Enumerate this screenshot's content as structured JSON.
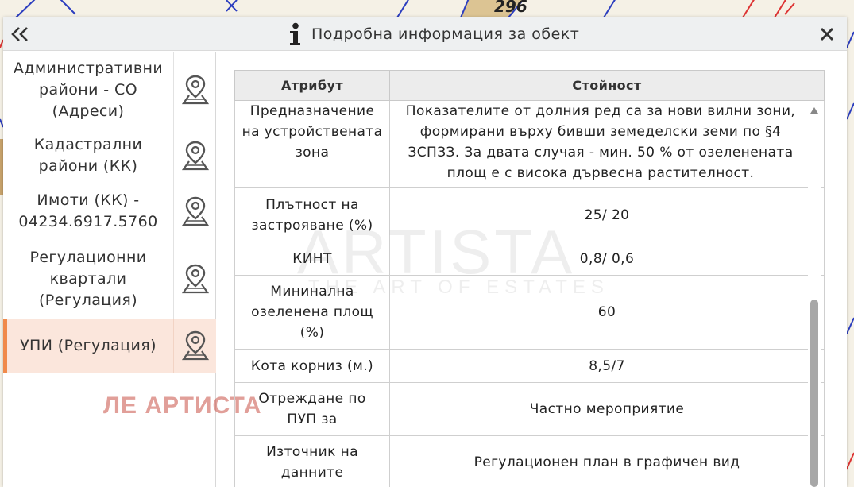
{
  "map": {
    "parcel_label": "296",
    "colors": {
      "blue_line": "#2b3dbf",
      "red_line": "#d33",
      "parcel_fill": "#dcc493"
    }
  },
  "header": {
    "title": "Подробна информация за обект",
    "collapse_icon": "double-chevron-left-icon",
    "info_icon": "info-icon",
    "close_icon": "close-icon"
  },
  "sidebar": {
    "items": [
      {
        "lines": [
          "Административни",
          "райони - СО",
          "(Адреси)"
        ],
        "active": false
      },
      {
        "lines": [
          "Кадастрални",
          "райони (КК)"
        ],
        "active": false
      },
      {
        "lines": [
          "Имоти (КК) -",
          "04234.6917.5760"
        ],
        "active": false
      },
      {
        "lines": [
          "Регулационни",
          "квартали",
          "(Регулация)"
        ],
        "active": false
      },
      {
        "lines": [
          "УПИ (Регулация)"
        ],
        "active": true
      }
    ],
    "pin_icon": "map-pin-icon",
    "active_color": "#fbe6dc",
    "active_bar_color": "#f08a4b"
  },
  "watermark_red": "ЛЕ АРТИСТА",
  "watermark_grey": {
    "main": "ARTISTA",
    "sub": "THE ART OF ESTATES"
  },
  "table": {
    "headers": {
      "attribute": "Атрибут",
      "value": "Стойност"
    },
    "rows": [
      {
        "attribute": [
          "Предназначение",
          "на устройствената",
          "зона"
        ],
        "value": [
          "Показателите от долния ред са за нови вилни зони,",
          "формирани върху бивши земеделски земи по §4",
          "ЗСПЗЗ. За двата случая - мин. 50 % от озеленената",
          "площ е с висока дървесна растителност."
        ]
      },
      {
        "attribute": [
          "Плътност на",
          "застрояване (%)"
        ],
        "value": [
          "25/ 20"
        ]
      },
      {
        "attribute": [
          "КИНТ"
        ],
        "value": [
          "0,8/ 0,6"
        ]
      },
      {
        "attribute": [
          "Мининална",
          "озеленена площ",
          "(%)"
        ],
        "value": [
          "60"
        ]
      },
      {
        "attribute": [
          "Кота корниз (м.)"
        ],
        "value": [
          "8,5/7"
        ]
      },
      {
        "attribute": [
          "Отреждане по",
          "ПУП за"
        ],
        "value": [
          "Частно мероприятие"
        ]
      },
      {
        "attribute": [
          "Източник на",
          "данните"
        ],
        "value": [
          "Регулационен план в графичен вид"
        ]
      }
    ]
  }
}
